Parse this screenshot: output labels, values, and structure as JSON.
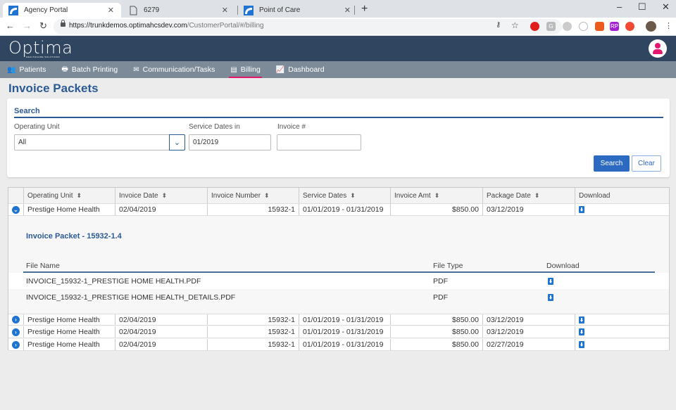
{
  "browser": {
    "tabs": [
      {
        "title": "Agency Portal",
        "active": true,
        "icon": "optima-favicon"
      },
      {
        "title": "6279",
        "active": false,
        "icon": "page-icon"
      },
      {
        "title": "Point of Care",
        "active": false,
        "icon": "optima-favicon"
      }
    ],
    "new_tab": "+",
    "url_host": "https://trunkdemos.optimahcsdev.com",
    "url_path": "/CustomerPortal/#/billing",
    "window_controls": {
      "minimize": "–",
      "maximize": "☐",
      "close": "✕"
    }
  },
  "app": {
    "logo": "Optima",
    "logo_sub": "HEALTHCARE SOLUTIONS",
    "brand_color": "#2f4560",
    "accent_color": "#e4176f"
  },
  "nav": {
    "items": [
      {
        "label": "Patients",
        "icon": "users-icon"
      },
      {
        "label": "Batch Printing",
        "icon": "printer-icon"
      },
      {
        "label": "Communication/Tasks",
        "icon": "envelope-icon"
      },
      {
        "label": "Billing",
        "icon": "invoice-icon",
        "active": true
      },
      {
        "label": "Dashboard",
        "icon": "chart-icon"
      }
    ]
  },
  "page": {
    "title": "Invoice Packets"
  },
  "search": {
    "heading": "Search",
    "operating_unit_label": "Operating Unit",
    "operating_unit_value": "All",
    "service_dates_label": "Service Dates in",
    "service_dates_value": "01/2019",
    "invoice_label": "Invoice #",
    "invoice_value": "",
    "search_button": "Search",
    "clear_button": "Clear"
  },
  "grid": {
    "columns": [
      "Operating Unit",
      "Invoice Date",
      "Invoice Number",
      "Service Dates",
      "Invoice Amt",
      "Package Date",
      "Download"
    ],
    "rows": [
      {
        "operating_unit": "Prestige Home Health",
        "invoice_date": "02/04/2019",
        "invoice_number": "15932-1",
        "service_dates": "01/01/2019 - 01/31/2019",
        "invoice_amt": "$850.00",
        "package_date": "03/12/2019",
        "expanded": true
      },
      {
        "operating_unit": "Prestige Home Health",
        "invoice_date": "02/04/2019",
        "invoice_number": "15932-1",
        "service_dates": "01/01/2019 - 01/31/2019",
        "invoice_amt": "$850.00",
        "package_date": "03/12/2019",
        "expanded": false
      },
      {
        "operating_unit": "Prestige Home Health",
        "invoice_date": "02/04/2019",
        "invoice_number": "15932-1",
        "service_dates": "01/01/2019 - 01/31/2019",
        "invoice_amt": "$850.00",
        "package_date": "03/12/2019",
        "expanded": false
      },
      {
        "operating_unit": "Prestige Home Health",
        "invoice_date": "02/04/2019",
        "invoice_number": "15932-1",
        "service_dates": "01/01/2019 - 01/31/2019",
        "invoice_amt": "$850.00",
        "package_date": "02/27/2019",
        "expanded": false
      }
    ],
    "detail": {
      "title": "Invoice Packet - 15932-1.4",
      "columns": [
        "File Name",
        "File Type",
        "Download"
      ],
      "files": [
        {
          "name": "INVOICE_15932-1_PRESTIGE HOME HEALTH.PDF",
          "type": "PDF"
        },
        {
          "name": "INVOICE_15932-1_PRESTIGE HOME HEALTH_DETAILS.PDF",
          "type": "PDF"
        }
      ]
    }
  }
}
